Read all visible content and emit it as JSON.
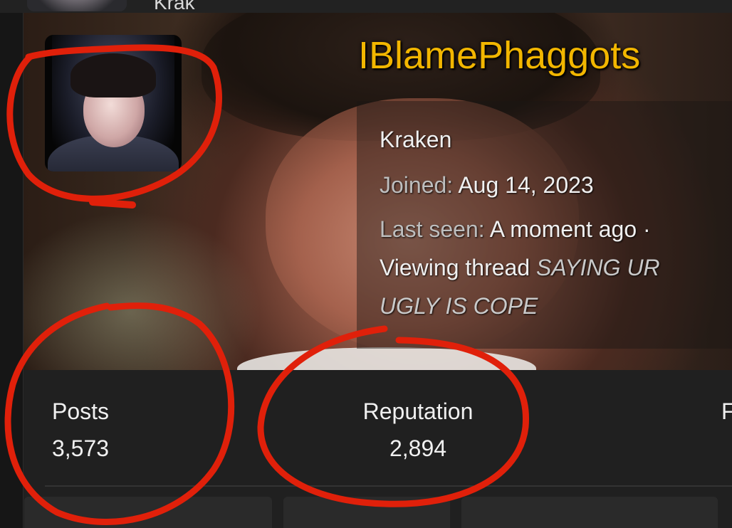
{
  "top_strip": {
    "partial_text": "Krak"
  },
  "profile": {
    "username": "IBlamePhaggots",
    "title": "Kraken",
    "joined_label": "Joined:",
    "joined_value": "Aug 14, 2023",
    "last_seen_label": "Last seen:",
    "last_seen_value": "A moment ago ·",
    "viewing_prefix": "Viewing thread",
    "viewing_thread_line1": "SAYING UR",
    "viewing_thread_line2": "UGLY IS COPE"
  },
  "stats": {
    "posts_label": "Posts",
    "posts_value": "3,573",
    "reputation_label": "Reputation",
    "reputation_value": "2,894",
    "third_label_partial": "F"
  },
  "colors": {
    "username": "#f2b600",
    "annotation": "#e0200a",
    "background": "#202020"
  }
}
